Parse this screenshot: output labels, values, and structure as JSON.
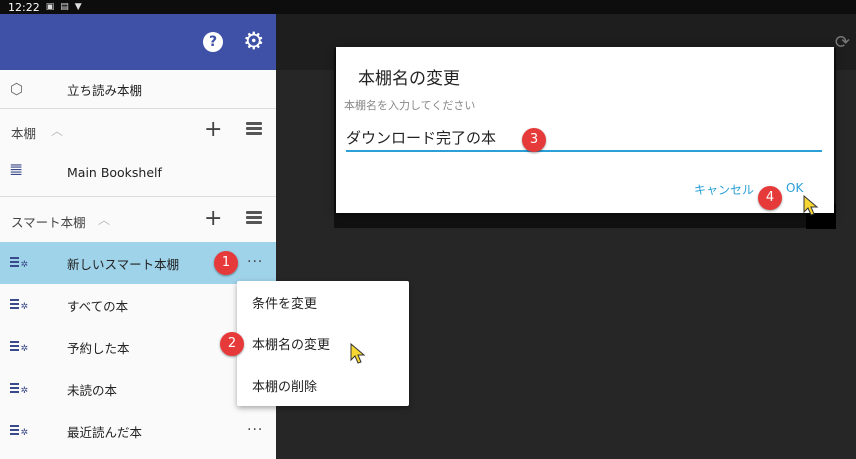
{
  "statusbar": {
    "time": "12:22",
    "icons": [
      "a-icon",
      "sim-icon",
      "download-icon"
    ]
  },
  "drawer": {
    "preview_shelf": {
      "label": "立ち読み本棚",
      "icon": "cube-icon"
    },
    "bookshelves_section": {
      "label": "本棚"
    },
    "main_bookshelf": {
      "label": "Main Bookshelf",
      "icon": "books-icon"
    },
    "smart_section": {
      "label": "スマート本棚"
    },
    "smart_items": [
      {
        "label": "新しいスマート本棚",
        "selected": true
      },
      {
        "label": "すべての本"
      },
      {
        "label": "予約した本"
      },
      {
        "label": "未読の本"
      },
      {
        "label": "最近読んだ本"
      }
    ]
  },
  "popup_menu": {
    "items": [
      "条件を変更",
      "本棚名の変更",
      "本棚の削除"
    ]
  },
  "dialog": {
    "title": "本棚名の変更",
    "prompt": "本棚名を入力してください",
    "value": "ダウンロード完了の本",
    "cancel_label": "キャンセル",
    "ok_label": "OK"
  },
  "markers": [
    "1",
    "2",
    "3",
    "4"
  ],
  "colors": {
    "header": "#3f51a7",
    "selected": "#9fd3ea",
    "accent": "#2aa0d6",
    "marker": "#e63a3a"
  }
}
